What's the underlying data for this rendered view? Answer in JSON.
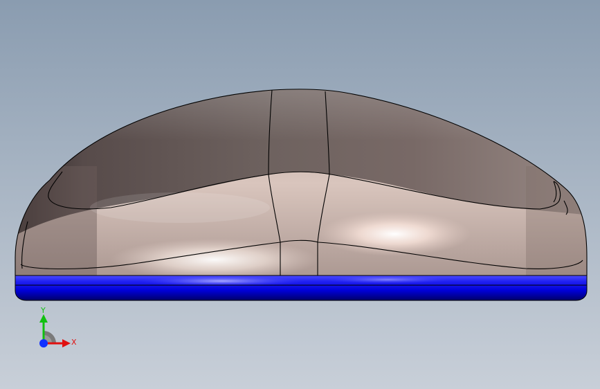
{
  "viewport": {
    "background_top": "#8a9cb0",
    "background_bottom": "#c8cfd8"
  },
  "model": {
    "body_color": "#8a7a78",
    "base_color": "#0000ee",
    "edge_color": "#000000"
  },
  "triad": {
    "x_label": "X",
    "y_label": "Y",
    "x_color": "#e01010",
    "y_color": "#10c010",
    "z_color": "#1030ff",
    "icon": "coordinate-triad-icon"
  }
}
